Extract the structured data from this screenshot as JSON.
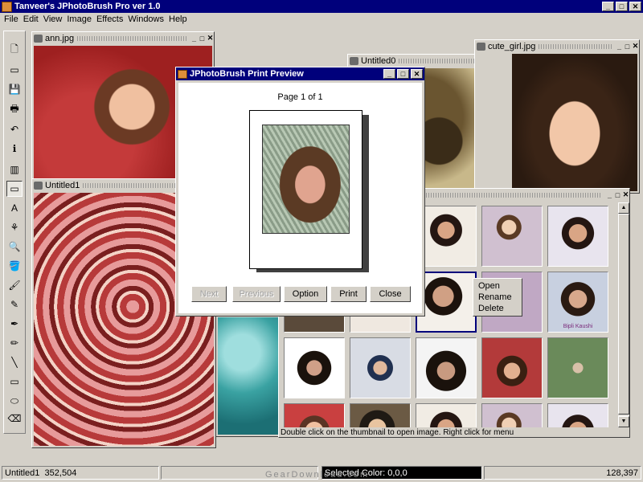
{
  "app": {
    "title": "Tanveer's JPhotoBrush Pro ver 1.0"
  },
  "window_buttons": {
    "minimize": "_",
    "maximize": "□",
    "close": "✕"
  },
  "menu": [
    "File",
    "Edit",
    "View",
    "Image",
    "Effects",
    "Windows",
    "Help"
  ],
  "toolbar": {
    "tools": [
      {
        "name": "new-icon",
        "glyph": "🗋"
      },
      {
        "name": "open-icon",
        "glyph": "▭"
      },
      {
        "name": "save-icon",
        "glyph": "💾"
      },
      {
        "name": "print-icon",
        "glyph": "🖶"
      },
      {
        "name": "undo-icon",
        "glyph": "↶"
      },
      {
        "name": "info-icon",
        "glyph": "ℹ"
      },
      {
        "name": "palette-icon",
        "glyph": "▥"
      },
      {
        "name": "select-rect-icon",
        "glyph": "▭"
      },
      {
        "name": "text-icon",
        "glyph": "A"
      },
      {
        "name": "clone-icon",
        "glyph": "⚘"
      },
      {
        "name": "zoom-icon",
        "glyph": "🔍"
      },
      {
        "name": "fill-icon",
        "glyph": "🪣"
      },
      {
        "name": "brush-icon",
        "glyph": "🖌"
      },
      {
        "name": "airbrush-icon",
        "glyph": "✎"
      },
      {
        "name": "dropper-icon",
        "glyph": "✒"
      },
      {
        "name": "pencil-icon",
        "glyph": "✏"
      },
      {
        "name": "line-icon",
        "glyph": "╲"
      },
      {
        "name": "rectangle-icon",
        "glyph": "▭"
      },
      {
        "name": "ellipse-icon",
        "glyph": "⬭"
      },
      {
        "name": "eraser-icon",
        "glyph": "⌫"
      }
    ]
  },
  "windows": {
    "ann": {
      "title": "ann.jpg"
    },
    "untitled1": {
      "title": "Untitled1"
    },
    "untitled0": {
      "title": "Untitled0"
    },
    "cute_girl": {
      "title": "cute_girl.jpg"
    }
  },
  "print_preview": {
    "title": "JPhotoBrush  Print Preview",
    "page_label": "Page 1 of 1",
    "buttons": {
      "next": "Next",
      "previous": "Previous",
      "option": "Option",
      "print": "Print",
      "close": "Close"
    }
  },
  "browser": {
    "hint": "Double click on the thumbnail to open image. Right click for menu",
    "thumb_caption": "Bipli Kaushi"
  },
  "context_menu": [
    "Open",
    "Rename",
    "Delete"
  ],
  "status": {
    "window": "Untitled1",
    "coords": "352,504",
    "selected_color": "Selected Color: 0,0,0",
    "right_coords": "128,397"
  },
  "watermark": "GearDownload.com",
  "colors": {
    "title_bar": "#00007b",
    "face_bg": "#d4d0c8"
  }
}
